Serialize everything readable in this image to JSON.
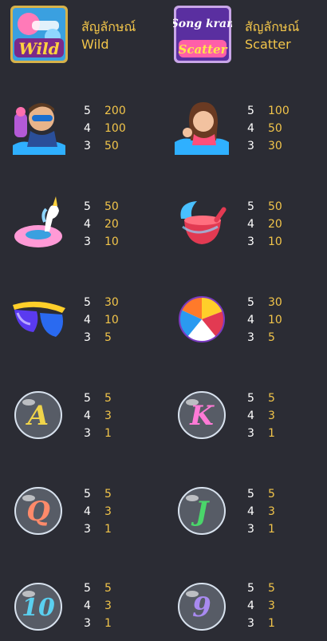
{
  "special": [
    {
      "label": "สัญลักษณ์",
      "name": "Wild"
    },
    {
      "label": "สัญลักษณ์",
      "name": "Scatter"
    }
  ],
  "logos": {
    "wild": "Wild",
    "scatter_top": "Song kran",
    "scatter_bottom": "Scatter"
  },
  "letters": {
    "A": "A",
    "K": "K",
    "Q": "Q",
    "J": "J",
    "ten": "10",
    "nine": "9"
  },
  "paytable": [
    {
      "icon": "man-with-water-gun-icon",
      "rows": [
        {
          "n": "5",
          "v": "200"
        },
        {
          "n": "4",
          "v": "100"
        },
        {
          "n": "3",
          "v": "50"
        }
      ]
    },
    {
      "icon": "woman-in-water-icon",
      "rows": [
        {
          "n": "5",
          "v": "100"
        },
        {
          "n": "4",
          "v": "50"
        },
        {
          "n": "3",
          "v": "30"
        }
      ]
    },
    {
      "icon": "unicorn-float-icon",
      "rows": [
        {
          "n": "5",
          "v": "50"
        },
        {
          "n": "4",
          "v": "20"
        },
        {
          "n": "3",
          "v": "10"
        }
      ]
    },
    {
      "icon": "water-bowl-icon",
      "rows": [
        {
          "n": "5",
          "v": "50"
        },
        {
          "n": "4",
          "v": "20"
        },
        {
          "n": "3",
          "v": "10"
        }
      ]
    },
    {
      "icon": "sunglasses-icon",
      "rows": [
        {
          "n": "5",
          "v": "30"
        },
        {
          "n": "4",
          "v": "10"
        },
        {
          "n": "3",
          "v": "5"
        }
      ]
    },
    {
      "icon": "beach-ball-icon",
      "rows": [
        {
          "n": "5",
          "v": "30"
        },
        {
          "n": "4",
          "v": "10"
        },
        {
          "n": "3",
          "v": "5"
        }
      ]
    },
    {
      "icon": "letter-a-bubble-icon",
      "rows": [
        {
          "n": "5",
          "v": "5"
        },
        {
          "n": "4",
          "v": "3"
        },
        {
          "n": "3",
          "v": "1"
        }
      ]
    },
    {
      "icon": "letter-k-bubble-icon",
      "rows": [
        {
          "n": "5",
          "v": "5"
        },
        {
          "n": "4",
          "v": "3"
        },
        {
          "n": "3",
          "v": "1"
        }
      ]
    },
    {
      "icon": "letter-q-bubble-icon",
      "rows": [
        {
          "n": "5",
          "v": "5"
        },
        {
          "n": "4",
          "v": "3"
        },
        {
          "n": "3",
          "v": "1"
        }
      ]
    },
    {
      "icon": "letter-j-bubble-icon",
      "rows": [
        {
          "n": "5",
          "v": "5"
        },
        {
          "n": "4",
          "v": "3"
        },
        {
          "n": "3",
          "v": "1"
        }
      ]
    },
    {
      "icon": "number-10-bubble-icon",
      "rows": [
        {
          "n": "5",
          "v": "5"
        },
        {
          "n": "4",
          "v": "3"
        },
        {
          "n": "3",
          "v": "1"
        }
      ]
    },
    {
      "icon": "number-9-bubble-icon",
      "rows": [
        {
          "n": "5",
          "v": "5"
        },
        {
          "n": "4",
          "v": "3"
        },
        {
          "n": "3",
          "v": "1"
        }
      ]
    }
  ]
}
